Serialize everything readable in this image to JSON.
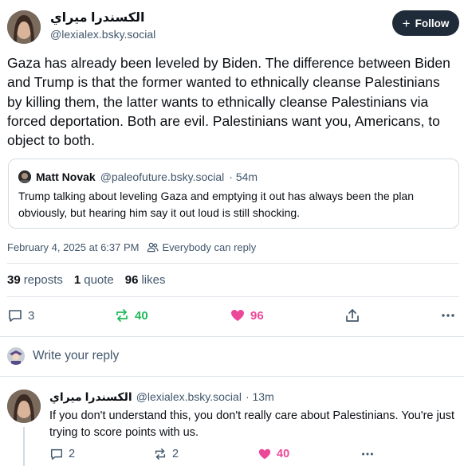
{
  "author": {
    "display_name": "الكسندرا ميراي",
    "handle": "@lexialex.bsky.social"
  },
  "follow_button": {
    "label": "Follow"
  },
  "post": {
    "text": "Gaza has already been leveled by Biden. The difference between Biden and Trump is that the former wanted to ethnically cleanse Palestinians by killing them, the latter wants to ethnically cleanse Palestinians via forced deportation. Both are evil. Palestinians want you, Americans, to object to both.",
    "timestamp": "February 4, 2025 at 6:37 PM",
    "reply_setting": "Everybody can reply"
  },
  "quote": {
    "name": "Matt Novak",
    "handle": "@paleofuture.bsky.social",
    "time": "· 54m",
    "text": "Trump talking about leveling Gaza and emptying it out has always been the plan obviously, but hearing him say it out loud is still shocking."
  },
  "counts": {
    "reposts_num": "39",
    "reposts_label": "reposts",
    "quotes_num": "1",
    "quotes_label": "quote",
    "likes_num": "96",
    "likes_label": "likes"
  },
  "actions": {
    "replies": "3",
    "reposts": "40",
    "likes": "96"
  },
  "reply_bar": {
    "placeholder": "Write your reply"
  },
  "reply": {
    "display_name": "الكسندرا ميراي",
    "handle": "@lexialex.bsky.social",
    "time": "· 13m",
    "text": "If you don't understand this, you don't really care about Palestinians. You're just trying to score points with us.",
    "replies": "2",
    "reposts": "2",
    "likes": "40"
  },
  "colors": {
    "repost_active": "#20bc5c",
    "like_active": "#ec4899",
    "follow_bg": "#1f2b38",
    "muted": "#42576c"
  }
}
